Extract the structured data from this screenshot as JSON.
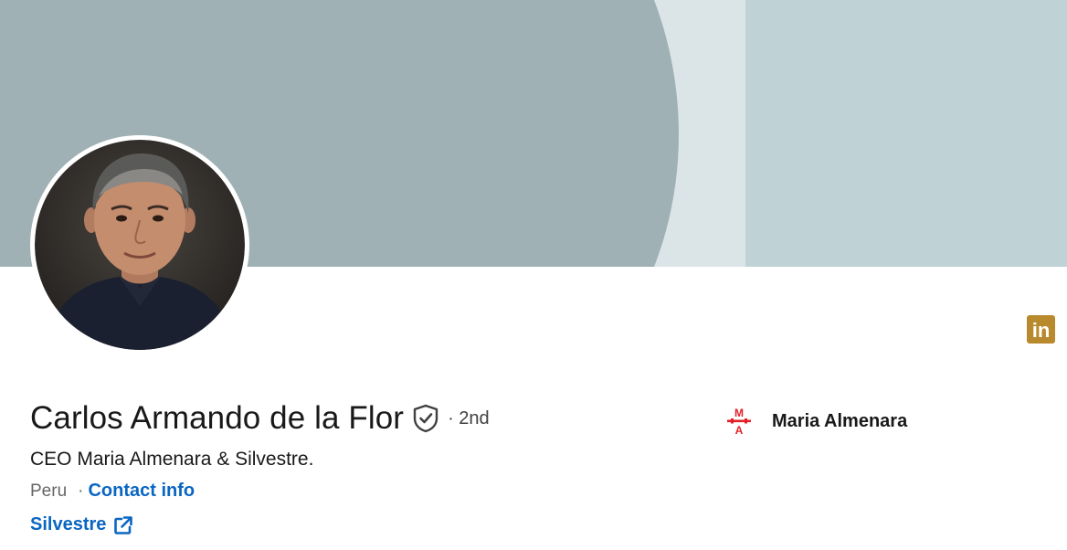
{
  "profile": {
    "name": "Carlos Armando de la Flor",
    "degree": "· 2nd",
    "headline": "CEO Maria Almenara & Silvestre.",
    "location": "Peru",
    "separator": "·",
    "contact_label": "Contact info",
    "website_label": "Silvestre",
    "company": {
      "name": "Maria Almenara",
      "logo_text_top": "M",
      "logo_text_bottom": "A"
    }
  },
  "icons": {
    "verified": "shield-check-icon",
    "external_link": "external-link-icon",
    "premium": "linkedin-in-icon",
    "premium_text": "in"
  },
  "colors": {
    "link": "#0a66c2",
    "premium_badge": "#b8892d",
    "banner_dark": "#a0b1b5",
    "banner_light": "#bfd3d7",
    "company_logo": "#e41e26"
  }
}
